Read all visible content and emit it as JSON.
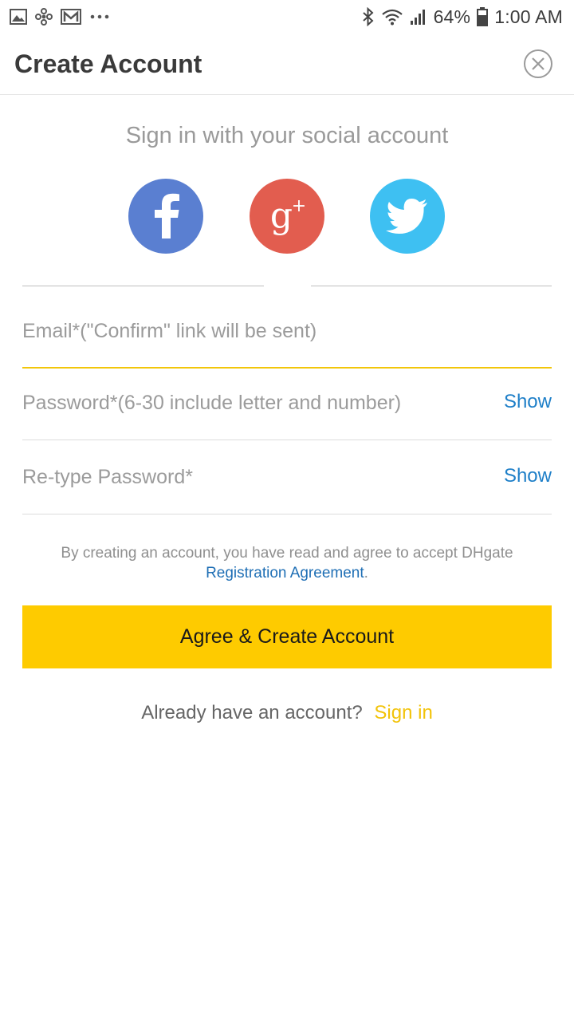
{
  "status_bar": {
    "left_icons": [
      "image-icon",
      "pinwheel-icon",
      "gmail-icon",
      "more-dots-icon"
    ],
    "right_icons": [
      "bluetooth-icon",
      "wifi-icon",
      "signal-icon",
      "battery-icon"
    ],
    "battery": "64%",
    "time": "1:00 AM"
  },
  "header": {
    "title": "Create Account",
    "close_icon": "close-circle-icon"
  },
  "social": {
    "heading": "Sign in with your social account",
    "buttons": [
      {
        "name": "facebook",
        "icon": "facebook-icon",
        "color": "#5a7fd1"
      },
      {
        "name": "google-plus",
        "icon": "google-plus-icon",
        "color": "#e25d4f"
      },
      {
        "name": "twitter",
        "icon": "twitter-icon",
        "color": "#3ec0f2"
      }
    ]
  },
  "form": {
    "email": {
      "value": "",
      "placeholder": "Email*(\"Confirm\" link will be sent)"
    },
    "password": {
      "value": "",
      "placeholder": "Password*(6-30 include letter and number)",
      "show_label": "Show"
    },
    "retype_password": {
      "value": "",
      "placeholder": "Re-type Password*",
      "show_label": "Show"
    }
  },
  "terms": {
    "text": "By creating an account, you have read and agree to accept DHgate",
    "link": "Registration Agreement",
    "suffix": "."
  },
  "primary_button": {
    "label": "Agree & Create Account",
    "color": "#fecb00"
  },
  "signin": {
    "prompt": "Already have an account?",
    "link": "Sign in"
  },
  "colors": {
    "accent": "#fecb00",
    "link_blue": "#1f6fb5",
    "signin_yellow": "#f2c30a"
  }
}
